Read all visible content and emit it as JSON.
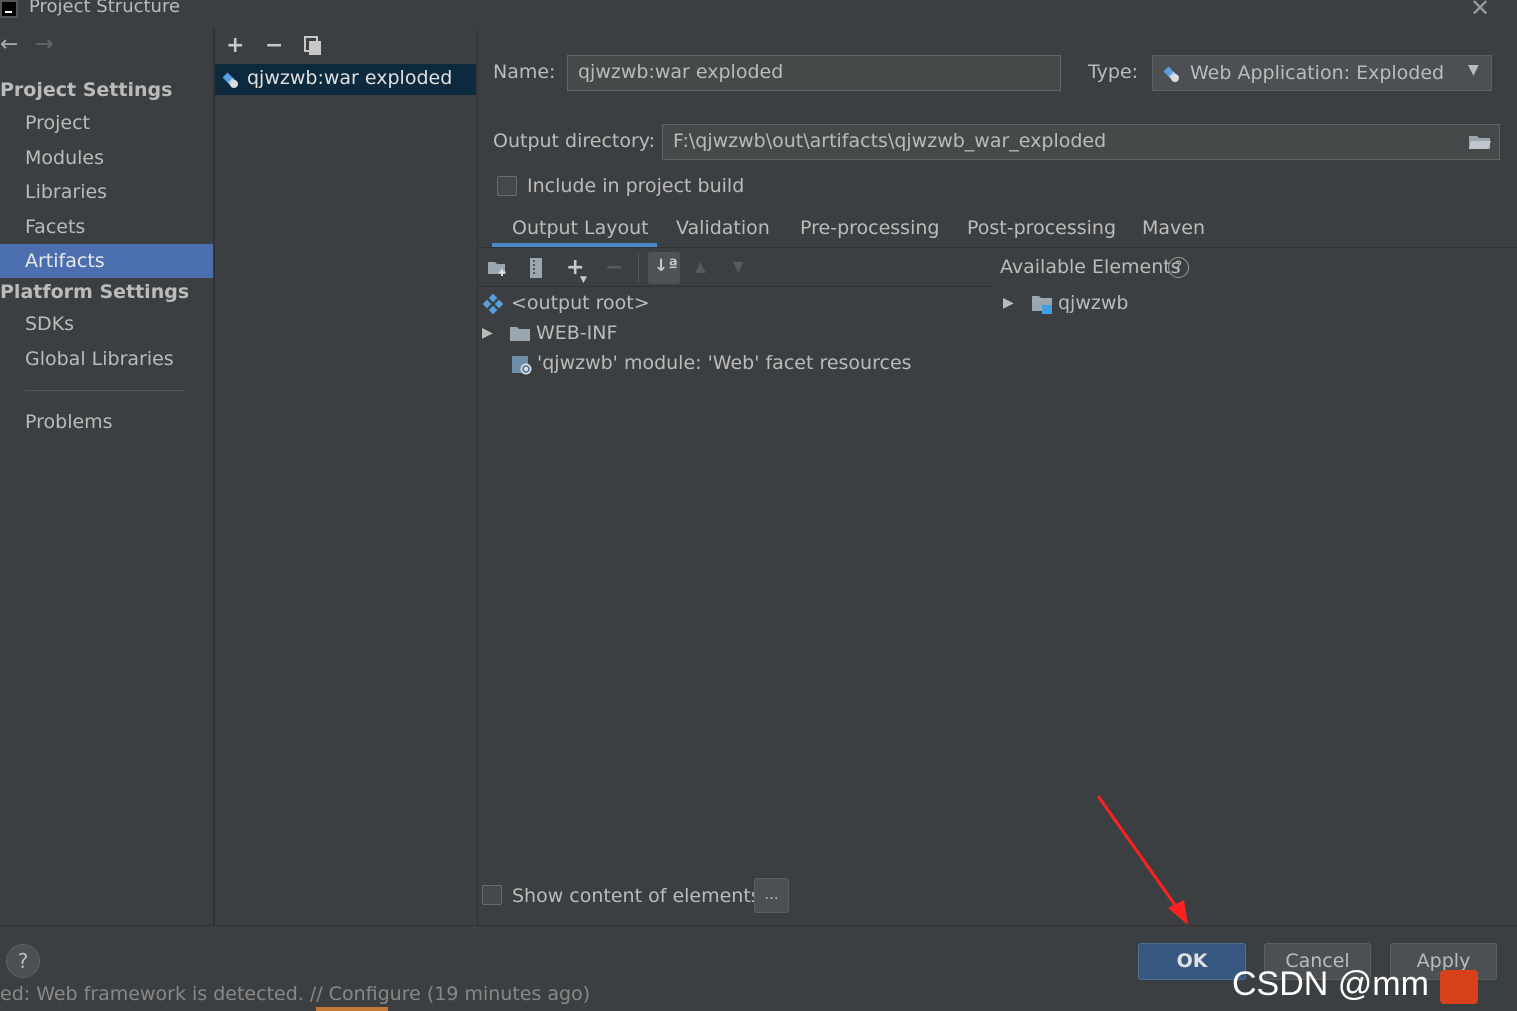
{
  "window": {
    "title": "Project Structure"
  },
  "nav": {
    "project_settings": "Project Settings",
    "items_project": [
      "Project",
      "Modules",
      "Libraries",
      "Facets",
      "Artifacts"
    ],
    "platform_settings": "Platform Settings",
    "items_platform": [
      "SDKs",
      "Global Libraries"
    ],
    "problems": "Problems",
    "selected": "Artifacts"
  },
  "artifacts": {
    "selected": "qjwzwb:war exploded"
  },
  "form": {
    "name_label": "Name:",
    "name_value": "qjwzwb:war exploded",
    "type_label": "Type:",
    "type_value": "Web Application: Exploded",
    "output_dir_label": "Output directory:",
    "output_dir_value": "F:\\qjwzwb\\out\\artifacts\\qjwzwb_war_exploded",
    "include_label": "Include in project build",
    "include_checked": false
  },
  "tabs": [
    "Output Layout",
    "Validation",
    "Pre-processing",
    "Post-processing",
    "Maven"
  ],
  "active_tab": "Output Layout",
  "layout_tree": {
    "root": "<output root>",
    "web_inf": "WEB-INF",
    "facet_resources": "'qjwzwb' module: 'Web' facet resources"
  },
  "available": {
    "title": "Available Elements",
    "items": [
      "qjwzwb"
    ]
  },
  "show_content_label": "Show content of elements",
  "more_button": "...",
  "buttons": {
    "ok": "OK",
    "cancel": "Cancel",
    "apply": "Apply",
    "help": "?"
  },
  "status": {
    "text": "ed: Web framework is detected. // Configure (19 minutes ago)"
  },
  "watermark": "CSDN @mm",
  "colors": {
    "selection": "#4b6eaf",
    "tab_underline": "#4a88c7",
    "ok_button": "#365880",
    "annotation_arrow": "#ff2020"
  },
  "icons": [
    "app-icon",
    "close-icon",
    "back-icon",
    "forward-icon",
    "add-icon",
    "remove-icon",
    "copy-icon",
    "artifact-icon",
    "folder-icon",
    "help-icon",
    "sort-icon",
    "arrow-up-icon",
    "arrow-down-icon"
  ]
}
